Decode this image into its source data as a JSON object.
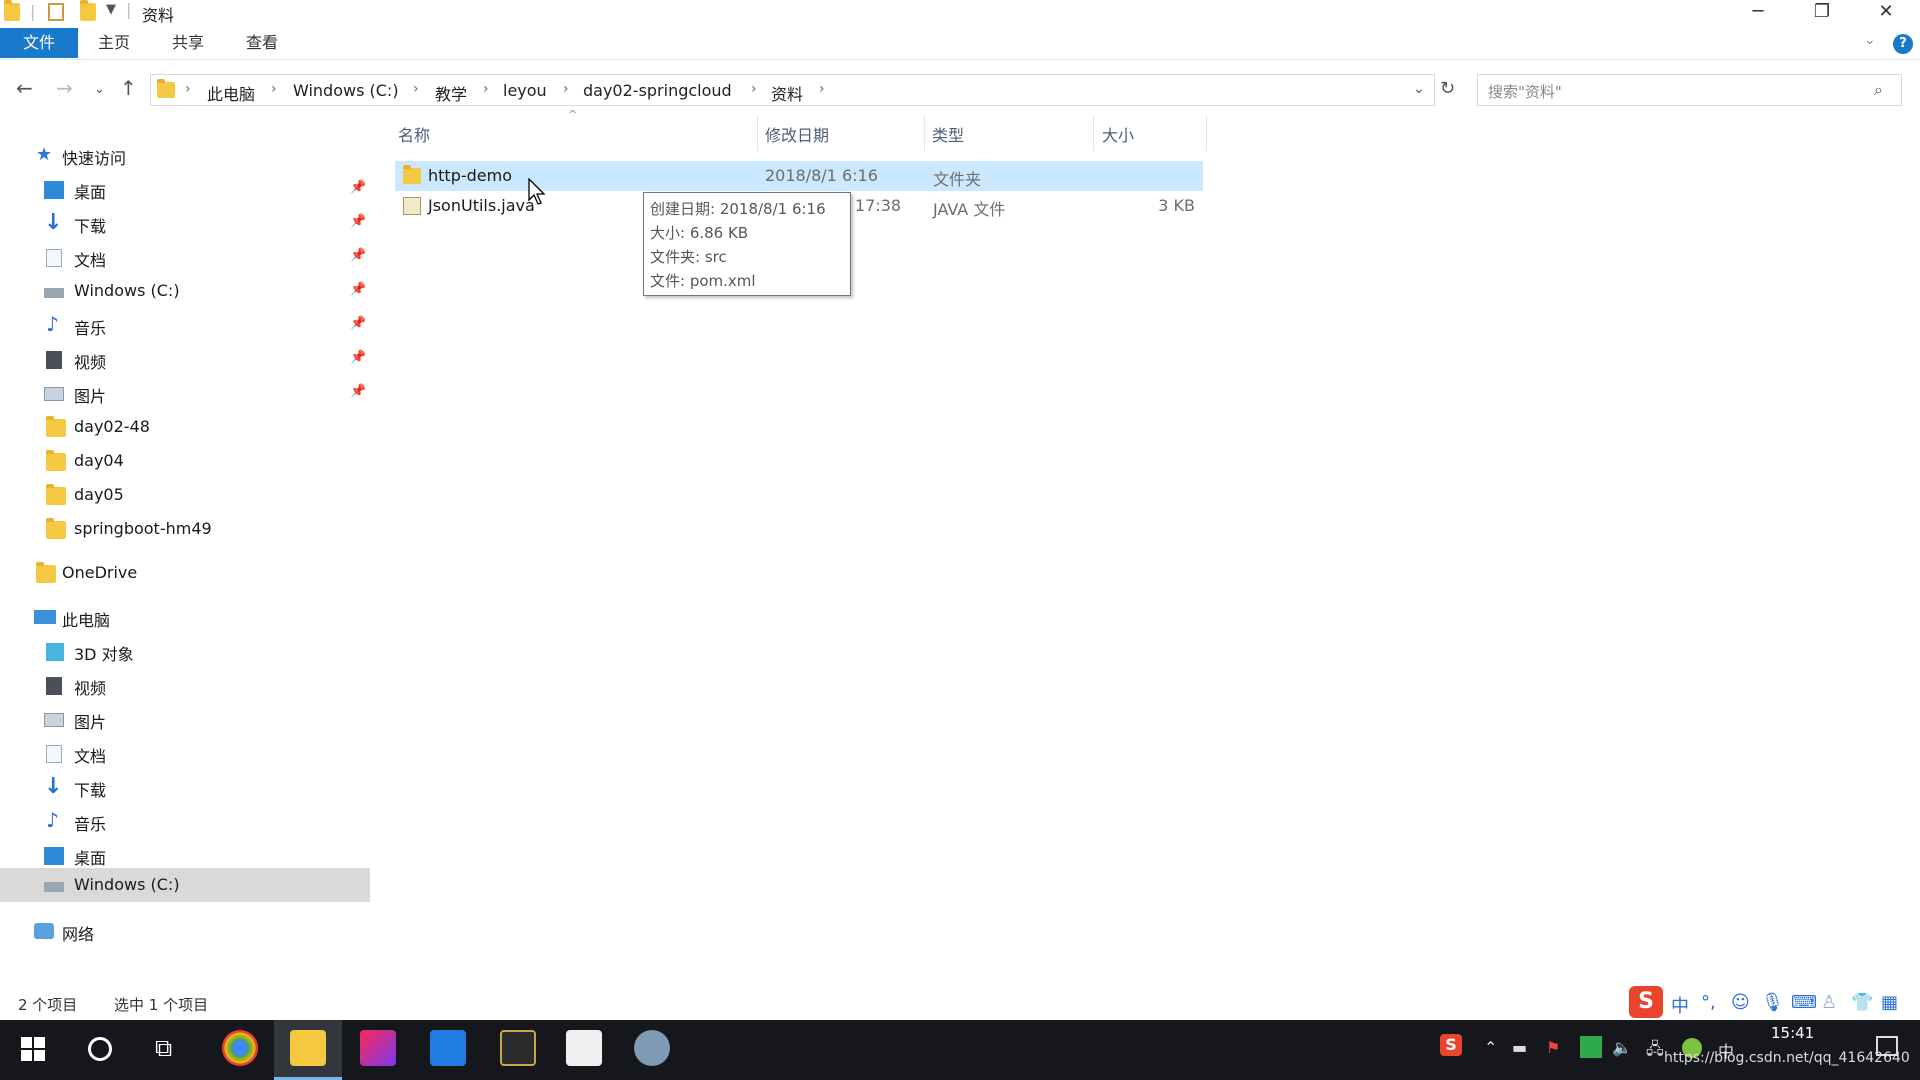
{
  "window": {
    "title": "资料",
    "controls": {
      "minimize": "─",
      "restore": "❐",
      "close": "✕"
    }
  },
  "ribbon": {
    "tabs": [
      "文件",
      "主页",
      "共享",
      "查看"
    ],
    "help": "?"
  },
  "address": {
    "crumbs": [
      "此电脑",
      "Windows (C:)",
      "教学",
      "leyou",
      "day02-springcloud",
      "资料"
    ],
    "search_placeholder": "搜索\"资料\""
  },
  "sidebar": {
    "quick_access": "快速访问",
    "quick_items": [
      {
        "label": "桌面",
        "icon": "desktop-icon",
        "pinned": true
      },
      {
        "label": "下载",
        "icon": "download-icon",
        "pinned": true
      },
      {
        "label": "文档",
        "icon": "document-icon",
        "pinned": true
      },
      {
        "label": "Windows (C:)",
        "icon": "drive-icon",
        "pinned": true
      },
      {
        "label": "音乐",
        "icon": "music-icon",
        "pinned": true
      },
      {
        "label": "视频",
        "icon": "video-icon",
        "pinned": true
      },
      {
        "label": "图片",
        "icon": "picture-icon",
        "pinned": true
      },
      {
        "label": "day02-48",
        "icon": "folder-icon",
        "pinned": false
      },
      {
        "label": "day04",
        "icon": "folder-icon",
        "pinned": false
      },
      {
        "label": "day05",
        "icon": "folder-icon",
        "pinned": false
      },
      {
        "label": "springboot-hm49",
        "icon": "folder-icon",
        "pinned": false
      }
    ],
    "onedrive": "OneDrive",
    "this_pc": "此电脑",
    "pc_items": [
      {
        "label": "3D 对象",
        "icon": "3d-objects-icon"
      },
      {
        "label": "视频",
        "icon": "video-icon"
      },
      {
        "label": "图片",
        "icon": "picture-icon"
      },
      {
        "label": "文档",
        "icon": "document-icon"
      },
      {
        "label": "下载",
        "icon": "download-icon"
      },
      {
        "label": "音乐",
        "icon": "music-icon"
      },
      {
        "label": "桌面",
        "icon": "desktop-icon"
      },
      {
        "label": "Windows (C:)",
        "icon": "drive-icon",
        "selected": true
      }
    ],
    "network": "网络"
  },
  "columns": {
    "name": "名称",
    "date": "修改日期",
    "type": "类型",
    "size": "大小"
  },
  "files": [
    {
      "name": "http-demo",
      "date": "2018/8/1 6:16",
      "type": "文件夹",
      "size": "",
      "selected": true
    },
    {
      "name": "JsonUtils.java",
      "date": "17:38",
      "type": "JAVA 文件",
      "size": "3 KB",
      "selected": false
    }
  ],
  "tooltip": {
    "created": "创建日期: 2018/8/1 6:16",
    "size": "大小: 6.86 KB",
    "folder": "文件夹: src",
    "file": "文件: pom.xml"
  },
  "status": {
    "count": "2 个项目",
    "selected": "选中 1 个项目"
  },
  "taskbar": {
    "time": "15:41",
    "url": "https://blog.csdn.net/qq_41642640",
    "ime": "中"
  },
  "colors": {
    "accent": "#1979ca",
    "selection": "#cce8ff",
    "taskbar": "#15171c"
  }
}
